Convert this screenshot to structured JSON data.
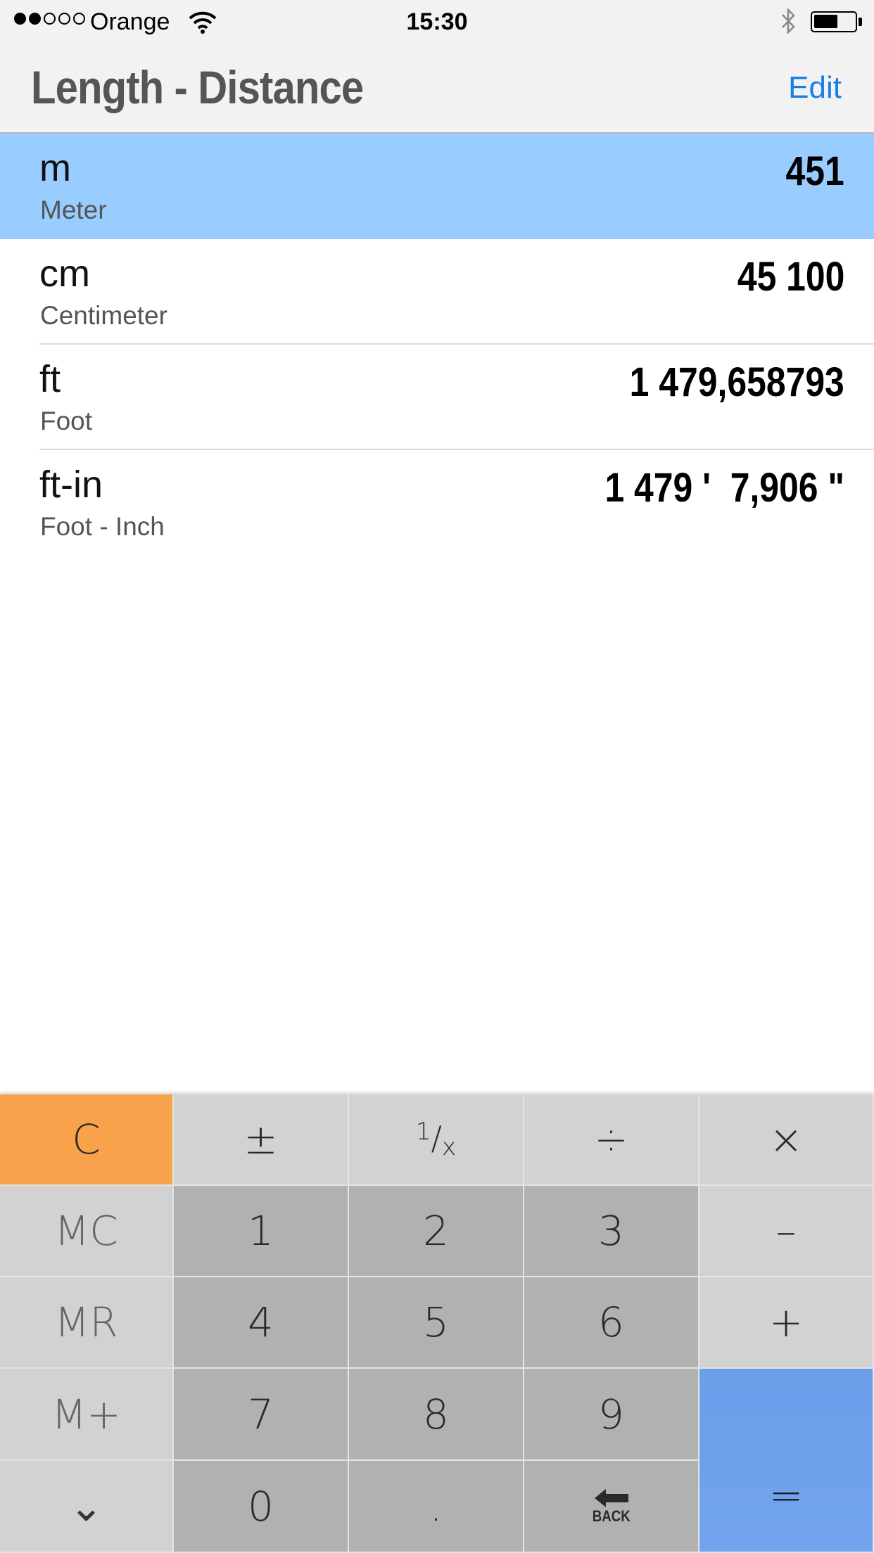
{
  "status_bar": {
    "carrier": "Orange",
    "time": "15:30",
    "signal_strength": 2,
    "signal_max": 5,
    "battery_level": 0.6
  },
  "nav": {
    "title": "Length - Distance",
    "edit_label": "Edit"
  },
  "units": [
    {
      "abbr": "m",
      "name": "Meter",
      "value": "451",
      "selected": true
    },
    {
      "abbr": "cm",
      "name": "Centimeter",
      "value": "45 100",
      "selected": false
    },
    {
      "abbr": "ft",
      "name": "Foot",
      "value": "1 479,658793",
      "selected": false
    },
    {
      "abbr": "ft-in",
      "name": "Foot - Inch",
      "value": "1 479 '  7,906 \"",
      "selected": false
    }
  ],
  "keypad": {
    "clear": "C",
    "plus_minus": "±",
    "reciprocal_num": "1",
    "reciprocal_den": "x",
    "divide": "÷",
    "multiply": "×",
    "mc": "MC",
    "mr": "MR",
    "mplus": "M+",
    "minus": "–",
    "plus": "+",
    "equals": "=",
    "dot": ".",
    "collapse": "⌄",
    "back": "BACK",
    "digits": [
      "0",
      "1",
      "2",
      "3",
      "4",
      "5",
      "6",
      "7",
      "8",
      "9"
    ]
  },
  "colors": {
    "selected_row": "#99ccff",
    "accent": "#1a7ee6",
    "clear_key": "#f8a24b",
    "equals_key": "#6b9eea"
  }
}
